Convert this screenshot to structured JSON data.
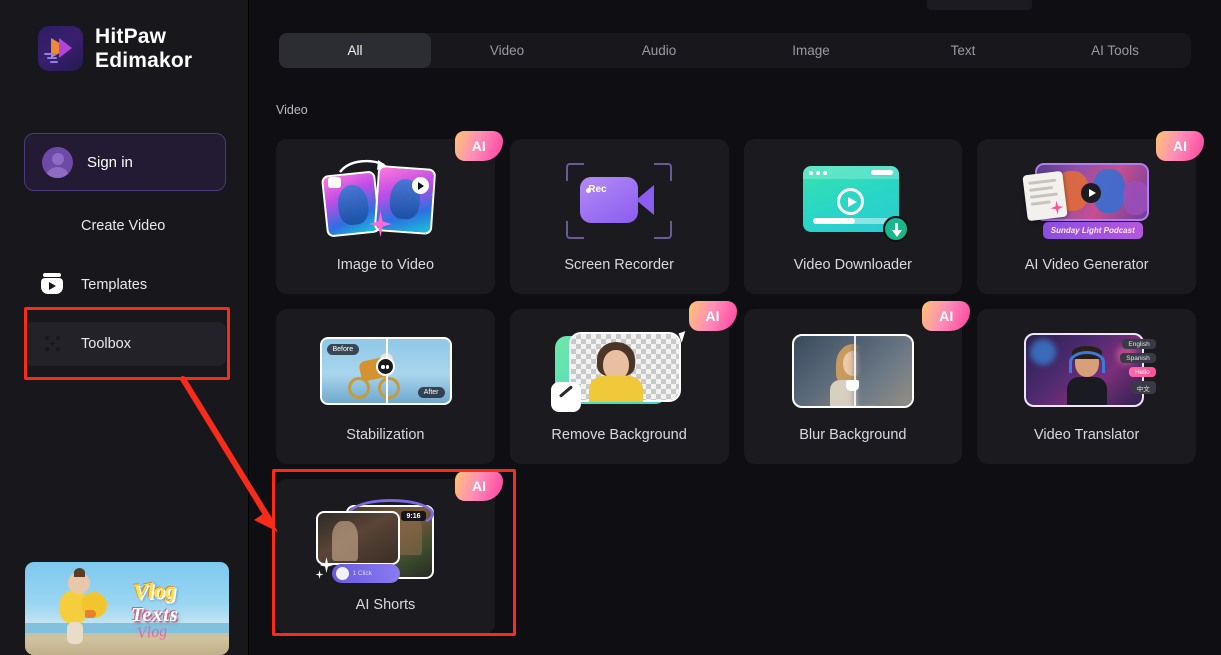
{
  "app": {
    "brand_line1": "HitPaw",
    "brand_line2": "Edimakor",
    "logo_icon": "hitpaw-logo-icon"
  },
  "sidebar": {
    "signin_label": "Sign in",
    "avatar_icon": "user-avatar-icon",
    "items": [
      {
        "label": "Create Video",
        "icon": "create-video-icon",
        "active": false
      },
      {
        "label": "Templates",
        "icon": "templates-icon",
        "active": false
      },
      {
        "label": "Toolbox",
        "icon": "toolbox-icon",
        "active": true
      }
    ],
    "promo": {
      "title": "Vlog",
      "subtitle": "Texts",
      "script": "Vlog"
    }
  },
  "main": {
    "tabs": [
      {
        "label": "All",
        "active": true
      },
      {
        "label": "Video",
        "active": false
      },
      {
        "label": "Audio",
        "active": false
      },
      {
        "label": "Image",
        "active": false
      },
      {
        "label": "Text",
        "active": false
      },
      {
        "label": "AI Tools",
        "active": false
      }
    ],
    "section_label": "Video",
    "ai_badge_label": "AI",
    "cards": [
      {
        "name": "Image to Video",
        "ai": true,
        "art": "i2v"
      },
      {
        "name": "Screen Recorder",
        "ai": false,
        "art": "rec",
        "rec_label": "Rec"
      },
      {
        "name": "Video Downloader",
        "ai": false,
        "art": "dl"
      },
      {
        "name": "AI Video Generator",
        "ai": true,
        "art": "avg",
        "caption": "Sunday Light Podcast"
      },
      {
        "name": "Stabilization",
        "ai": false,
        "art": "stb",
        "before": "Before",
        "after": "After"
      },
      {
        "name": "Remove Background",
        "ai": true,
        "art": "rbg"
      },
      {
        "name": "Blur Background",
        "ai": true,
        "art": "blr"
      },
      {
        "name": "Video Translator",
        "ai": false,
        "art": "trn",
        "chips": [
          "English",
          "Spanish",
          "Hello",
          "中文"
        ]
      },
      {
        "name": "AI Shorts",
        "ai": true,
        "art": "shr",
        "ratio": "9:16",
        "toggle_label": "1 Click"
      }
    ]
  },
  "annotations": {
    "highlight_color": "#f92c1c",
    "highlight_toolbox": "Toolbox",
    "highlight_ai_shorts": "AI Shorts",
    "arrow": "toolbox-to-ai-shorts-arrow"
  }
}
